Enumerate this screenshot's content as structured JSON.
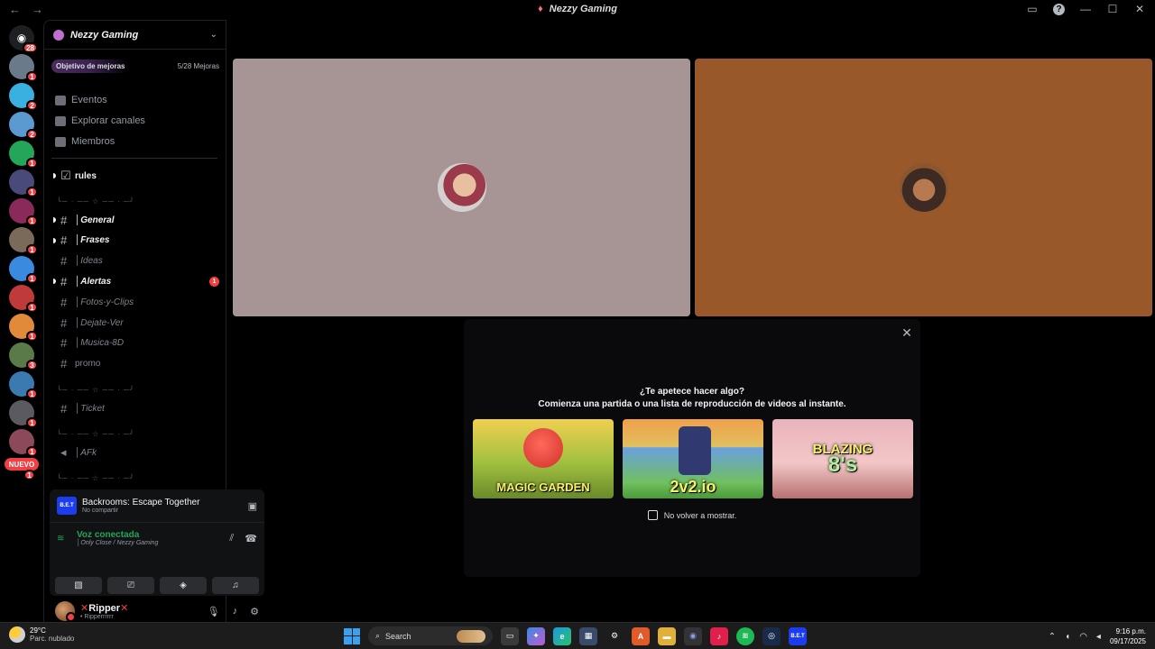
{
  "window": {
    "title": "Nezzy Gaming",
    "back": "←",
    "forward": "→"
  },
  "rail": {
    "dm_badge": "28",
    "servers": [
      {
        "color": "#6a7a8a",
        "badge": "1"
      },
      {
        "color": "#3ab0e0",
        "badge": "2"
      },
      {
        "color": "#5a9ad0",
        "badge": "2"
      },
      {
        "color": "#23a55a",
        "badge": "1"
      },
      {
        "color": "#4a4a7a",
        "badge": "1"
      },
      {
        "color": "#8a2a5a",
        "badge": "1"
      },
      {
        "color": "#7a6a5a",
        "badge": "1"
      },
      {
        "color": "#3a8ae0",
        "badge": "1"
      },
      {
        "color": "#c03a3a",
        "badge": "1"
      },
      {
        "color": "#e08a3a",
        "badge": "1"
      },
      {
        "color": "#5a7a4a",
        "badge": "3"
      },
      {
        "color": "#3a7ab0",
        "badge": "1"
      },
      {
        "color": "#5a5a60",
        "badge": "1"
      },
      {
        "color": "#8a4a5a",
        "badge": "1"
      }
    ],
    "new_label": "NUEVO",
    "new_badge": "1"
  },
  "sidebar": {
    "guild_name": "Nezzy Gaming",
    "boost_label": "Objetivo de mejoras",
    "boost_count": "5/28 Mejoras",
    "nav": [
      {
        "label": "Eventos"
      },
      {
        "label": "Explorar canales"
      },
      {
        "label": "Miembros"
      }
    ],
    "rules": "rules",
    "separator": "╰─ · ── ☆ ── · ─╯",
    "channels": [
      {
        "name": "│General",
        "bright": true,
        "unread": true
      },
      {
        "name": "│Frases",
        "bright": true,
        "unread": true
      },
      {
        "name": "│Ideas",
        "bright": false,
        "unread": false
      },
      {
        "name": "│Alertas",
        "bright": true,
        "unread": true,
        "mention": "1"
      },
      {
        "name": "│Fotos-y-Clips",
        "bright": false,
        "unread": false
      },
      {
        "name": "│Dejate-Ver",
        "bright": false,
        "unread": false
      },
      {
        "name": "│Musica-8D",
        "bright": false,
        "unread": false
      },
      {
        "name": "promo",
        "bright": false,
        "unread": false
      }
    ],
    "ticket": "│Ticket",
    "afk": "│AFk"
  },
  "activity": {
    "icon_text": "B.E.T",
    "title": "Backrooms: Escape Together",
    "subtitle": "No compartir"
  },
  "voice": {
    "status": "Voz conectada",
    "channel": "│Only Close / Nezzy Gaming"
  },
  "user": {
    "name": "Ripper",
    "status": "• Ripperrrrrr"
  },
  "overlay": {
    "question": "¿Te apetece hacer algo?",
    "subtitle": "Comienza una partida o una lista de reproducción de videos al instante.",
    "games": [
      {
        "title": "MAGIC GARDEN"
      },
      {
        "title": "2v2.io"
      },
      {
        "title": "BLAZING",
        "extra": "8's"
      }
    ],
    "dont_show": "No volver a mostrar."
  },
  "taskbar": {
    "temp": "29°C",
    "weather": "Parc. nublado",
    "search": "Search",
    "time": "9:16 p.m.",
    "date": "09/17/2025",
    "bet_icon": "B.E.T"
  }
}
